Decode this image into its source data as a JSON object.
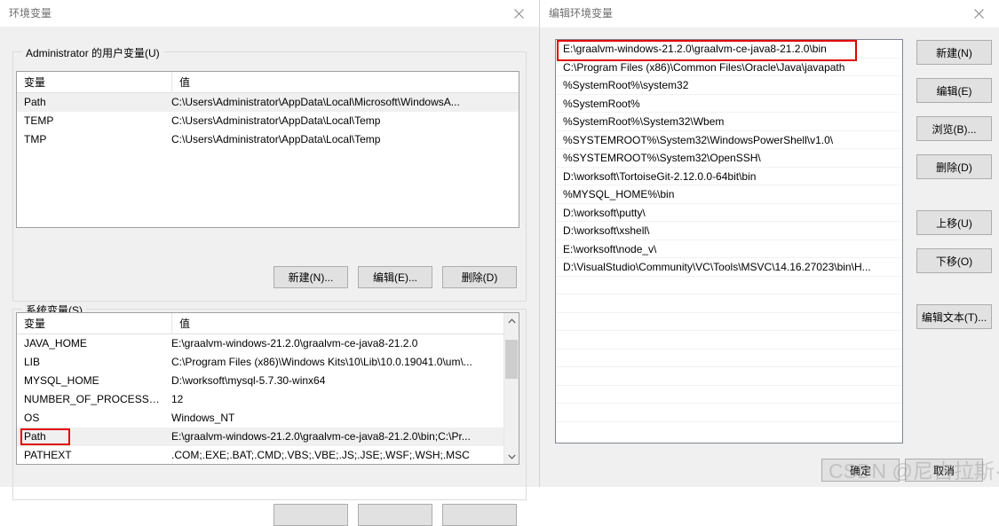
{
  "env_window": {
    "title": "环境变量",
    "close_icon": "close-icon",
    "user_group": {
      "legend": "Administrator 的用户变量(U)",
      "columns": [
        "变量",
        "值"
      ],
      "rows": [
        {
          "name": "Path",
          "value": "C:\\Users\\Administrator\\AppData\\Local\\Microsoft\\WindowsA...",
          "selected": true
        },
        {
          "name": "TEMP",
          "value": "C:\\Users\\Administrator\\AppData\\Local\\Temp",
          "selected": false
        },
        {
          "name": "TMP",
          "value": "C:\\Users\\Administrator\\AppData\\Local\\Temp",
          "selected": false
        }
      ],
      "buttons": {
        "new": "新建(N)...",
        "edit": "编辑(E)...",
        "delete": "删除(D)"
      }
    },
    "system_group": {
      "legend": "系统变量(S)",
      "columns": [
        "变量",
        "值"
      ],
      "rows": [
        {
          "name": "JAVA_HOME",
          "value": "E:\\graalvm-windows-21.2.0\\graalvm-ce-java8-21.2.0",
          "selected": false,
          "highlight": false
        },
        {
          "name": "LIB",
          "value": "C:\\Program Files (x86)\\Windows Kits\\10\\Lib\\10.0.19041.0\\um\\...",
          "selected": false,
          "highlight": false
        },
        {
          "name": "MYSQL_HOME",
          "value": "D:\\worksoft\\mysql-5.7.30-winx64",
          "selected": false,
          "highlight": false
        },
        {
          "name": "NUMBER_OF_PROCESSORS",
          "value": "12",
          "selected": false,
          "highlight": false
        },
        {
          "name": "OS",
          "value": "Windows_NT",
          "selected": false,
          "highlight": false
        },
        {
          "name": "Path",
          "value": "E:\\graalvm-windows-21.2.0\\graalvm-ce-java8-21.2.0\\bin;C:\\Pr...",
          "selected": true,
          "highlight": true
        },
        {
          "name": "PATHEXT",
          "value": ".COM;.EXE;.BAT;.CMD;.VBS;.VBE;.JS;.JSE;.WSF;.WSH;.MSC",
          "selected": false,
          "highlight": false
        }
      ],
      "scroll": {
        "up_icon": "chevron-up-icon",
        "down_icon": "chevron-down-icon"
      }
    }
  },
  "edit_window": {
    "title": "编辑环境变量",
    "close_icon": "close-icon",
    "path_entries": [
      {
        "value": "E:\\graalvm-windows-21.2.0\\graalvm-ce-java8-21.2.0\\bin",
        "highlight": true
      },
      {
        "value": "C:\\Program Files (x86)\\Common Files\\Oracle\\Java\\javapath",
        "highlight": false
      },
      {
        "value": "%SystemRoot%\\system32",
        "highlight": false
      },
      {
        "value": "%SystemRoot%",
        "highlight": false
      },
      {
        "value": "%SystemRoot%\\System32\\Wbem",
        "highlight": false
      },
      {
        "value": "%SYSTEMROOT%\\System32\\WindowsPowerShell\\v1.0\\",
        "highlight": false
      },
      {
        "value": "%SYSTEMROOT%\\System32\\OpenSSH\\",
        "highlight": false
      },
      {
        "value": "D:\\worksoft\\TortoiseGit-2.12.0.0-64bit\\bin",
        "highlight": false
      },
      {
        "value": "%MYSQL_HOME%\\bin",
        "highlight": false
      },
      {
        "value": "D:\\worksoft\\putty\\",
        "highlight": false
      },
      {
        "value": "D:\\worksoft\\xshell\\",
        "highlight": false
      },
      {
        "value": "E:\\worksoft\\node_v\\",
        "highlight": false
      },
      {
        "value": "D:\\VisualStudio\\Community\\VC\\Tools\\MSVC\\14.16.27023\\bin\\H...",
        "highlight": false
      }
    ],
    "empty_row_count": 8,
    "side_buttons": {
      "new": "新建(N)",
      "edit": "编辑(E)",
      "browse": "浏览(B)...",
      "delete": "删除(D)",
      "move_up": "上移(U)",
      "move_down": "下移(O)",
      "edit_text": "编辑文本(T)..."
    },
    "footer_buttons": {
      "ok": "确定",
      "cancel": "取消"
    }
  },
  "watermark": {
    "text": "CSDN @尼古拉斯·李"
  },
  "colors": {
    "highlight_red": "#e00000",
    "dialog_bg": "#f0f0f0",
    "list_bg": "#ffffff",
    "selection": "#f0f0f0"
  }
}
